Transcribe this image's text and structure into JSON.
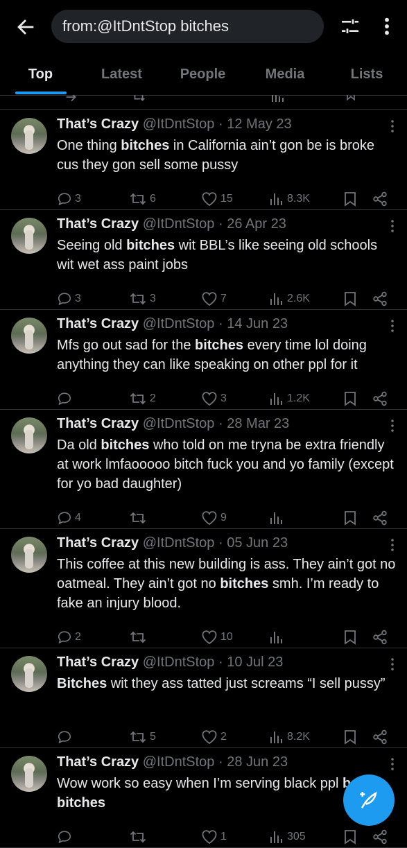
{
  "search": {
    "query": "from:@ItDntStop bitches"
  },
  "tabs": [
    "Top",
    "Latest",
    "People",
    "Media",
    "Lists"
  ],
  "tweets": [
    {
      "name": "That’s Crazy",
      "handle": "@ItDntStop",
      "date": "12 May 23",
      "text": [
        "One thing ",
        "bitches",
        " in California ain’t gon be is broke cus they gon sell some pussy"
      ],
      "replies": "3",
      "retweets": "6",
      "likes": "15",
      "views": "8.3K"
    },
    {
      "name": "That’s Crazy",
      "handle": "@ItDntStop",
      "date": "26 Apr 23",
      "text": [
        "Seeing old ",
        "bitches",
        " wit BBL’s like seeing old schools wit wet ass paint jobs"
      ],
      "replies": "3",
      "retweets": "3",
      "likes": "7",
      "views": "2.6K"
    },
    {
      "name": "That’s Crazy",
      "handle": "@ItDntStop",
      "date": "14 Jun 23",
      "text": [
        "Mfs go out sad for the ",
        "bitches",
        " every time lol doing anything they can like speaking on other ppl for it"
      ],
      "replies": "",
      "retweets": "2",
      "likes": "3",
      "views": "1.2K"
    },
    {
      "name": "That’s Crazy",
      "handle": "@ItDntStop",
      "date": "28 Mar 23",
      "text": [
        "Da old ",
        "bitches",
        " who told on me tryna be extra friendly at work lmfaooooo bitch fuck you and yo family (except for yo bad daughter)"
      ],
      "replies": "4",
      "retweets": "",
      "likes": "9",
      "views": ""
    },
    {
      "name": "That’s Crazy",
      "handle": "@ItDntStop",
      "date": "05 Jun 23",
      "text": [
        "This coffee at this new building is ass. They ain’t got no oatmeal. They ain’t got no ",
        "bitches",
        " smh. I’m ready to fake an injury blood."
      ],
      "replies": "2",
      "retweets": "",
      "likes": "10",
      "views": ""
    },
    {
      "name": "That’s Crazy",
      "handle": "@ItDntStop",
      "date": "10 Jul 23",
      "text": [
        "",
        "Bitches",
        " wit they ass tatted just screams “I sell pussy”"
      ],
      "replies": "",
      "retweets": "5",
      "likes": "2",
      "views": "8.2K"
    },
    {
      "name": "That’s Crazy",
      "handle": "@ItDntStop",
      "date": "28 Jun 23",
      "text": [
        "Wow work so easy when I’m serving black ppl ",
        "bad bitches",
        ""
      ],
      "replies": "",
      "retweets": "",
      "likes": "1",
      "views": "305"
    }
  ],
  "colors": {
    "accent": "#1d9bf0",
    "muted": "#71767b",
    "text": "#e7e9ea",
    "divider": "#2f3336"
  }
}
